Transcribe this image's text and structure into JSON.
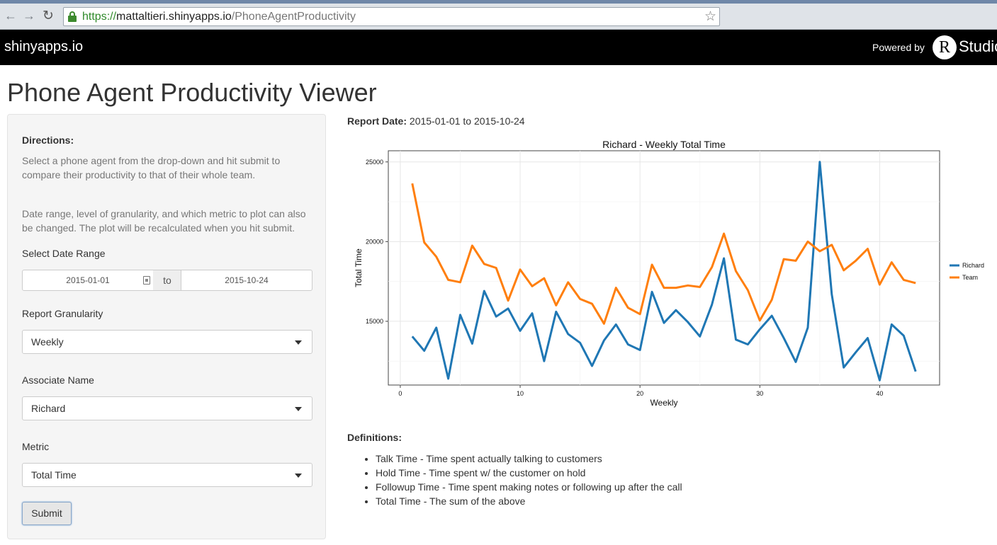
{
  "browser": {
    "url_scheme": "https://",
    "url_host": "mattaltieri.shinyapps.io",
    "url_path": "/PhoneAgentProductivity"
  },
  "header": {
    "brand": "shinyapps.io",
    "powered_by": "Powered by",
    "r_letter": "R",
    "studio": "Studio"
  },
  "page": {
    "title": "Phone Agent Productivity Viewer"
  },
  "sidebar": {
    "directions_label": "Directions:",
    "directions_text_1": "Select a phone agent from the drop-down and hit submit to compare their productivity to that of their whole team.",
    "directions_text_2": "Date range, level of granularity, and which metric to plot can also be changed. The plot will be recalculated when you hit submit.",
    "date_range_label": "Select Date Range",
    "date_start": "2015-01-01",
    "date_separator": "to",
    "date_end": "2015-10-24",
    "granularity_label": "Report Granularity",
    "granularity_value": "Weekly",
    "associate_label": "Associate Name",
    "associate_value": "Richard",
    "metric_label": "Metric",
    "metric_value": "Total Time",
    "submit_label": "Submit"
  },
  "main": {
    "report_date_label": "Report Date:",
    "report_date_value": "2015-01-01 to 2015-10-24",
    "definitions_label": "Definitions:",
    "definitions": [
      "Talk Time - Time spent actually talking to customers",
      "Hold Time - Time spent w/ the customer on hold",
      "Followup Time - Time spent making notes or following up after the call",
      "Total Time - The sum of the above"
    ]
  },
  "chart_data": {
    "type": "line",
    "title": "Richard - Weekly Total Time",
    "xlabel": "Weekly",
    "ylabel": "Total Time",
    "xlim": [
      -1,
      45
    ],
    "ylim": [
      11000,
      25700
    ],
    "x_ticks": [
      0,
      10,
      20,
      30,
      40
    ],
    "y_ticks": [
      15000,
      20000,
      25000
    ],
    "grid": true,
    "legend_position": "right",
    "x": [
      1,
      2,
      3,
      4,
      5,
      6,
      7,
      8,
      9,
      10,
      11,
      12,
      13,
      14,
      15,
      16,
      17,
      18,
      19,
      20,
      21,
      22,
      23,
      24,
      25,
      26,
      27,
      28,
      29,
      30,
      31,
      32,
      33,
      34,
      35,
      36,
      37,
      38,
      39,
      40,
      41,
      42,
      43
    ],
    "series": [
      {
        "name": "Richard",
        "color": "#1f77b4",
        "values": [
          14050,
          13150,
          14600,
          11400,
          15400,
          13600,
          16900,
          15300,
          15800,
          14400,
          15500,
          12500,
          15600,
          14200,
          13650,
          12200,
          13800,
          14800,
          13550,
          13200,
          16850,
          14900,
          15700,
          14950,
          14050,
          16050,
          18950,
          13850,
          13550,
          14500,
          15350,
          13950,
          12450,
          14600,
          25000,
          16700,
          12100,
          13050,
          13950,
          11300,
          14800,
          14100,
          11850
        ]
      },
      {
        "name": "Team",
        "color": "#ff7f0e",
        "values": [
          23650,
          19950,
          19050,
          17600,
          17450,
          19750,
          18600,
          18350,
          16300,
          18250,
          17200,
          17700,
          16000,
          17450,
          16400,
          16100,
          14850,
          17100,
          15850,
          15450,
          18550,
          17100,
          17100,
          17250,
          17150,
          18400,
          20500,
          18150,
          16950,
          15050,
          16350,
          18900,
          18800,
          20000,
          19400,
          19800,
          18200,
          18800,
          19550,
          17300,
          18700,
          17600,
          17400
        ]
      }
    ]
  }
}
